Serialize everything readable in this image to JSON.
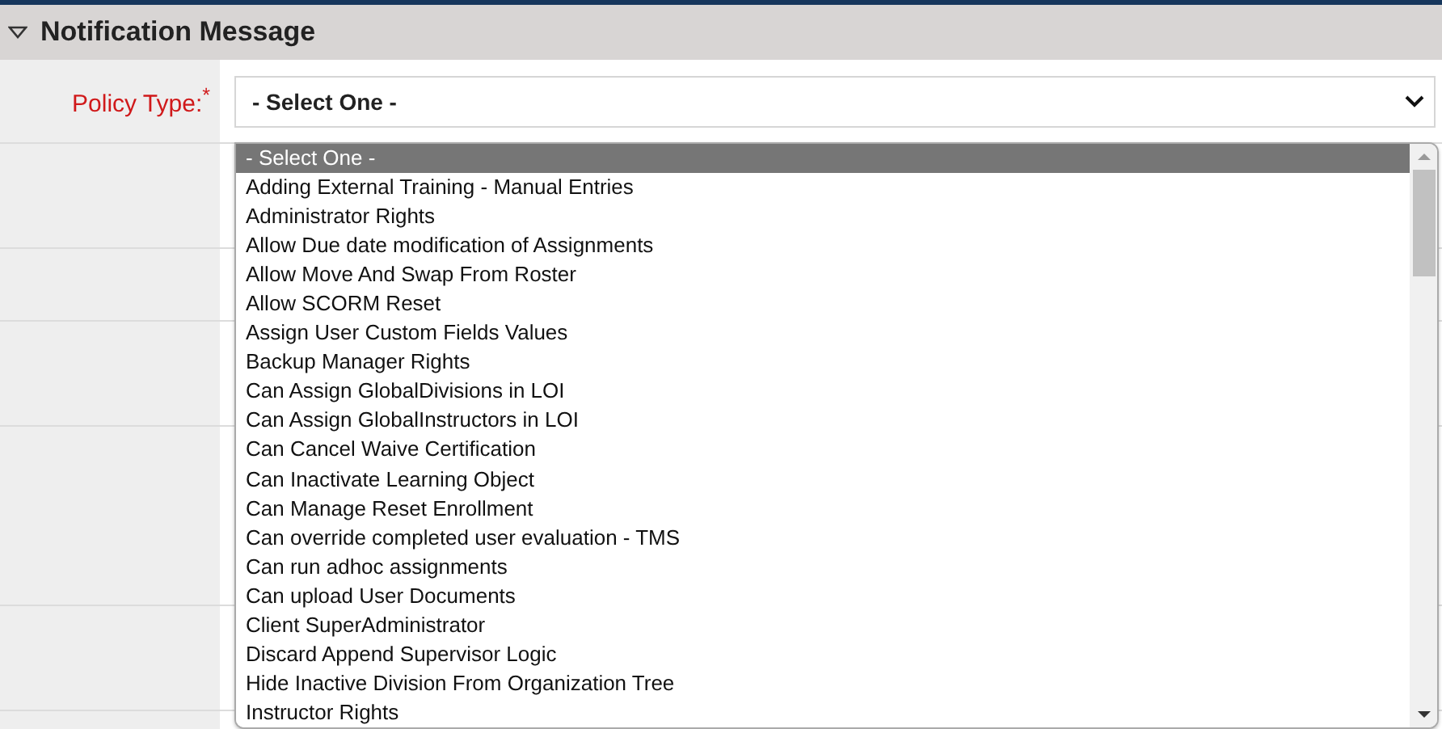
{
  "section": {
    "title": "Notification Message",
    "expanded": true
  },
  "field": {
    "label": "Policy Type:",
    "required": true,
    "required_mark": "*",
    "value": "- Select One -"
  },
  "options": [
    {
      "label": "- Select One -",
      "selected": true
    },
    {
      "label": "Adding External Training - Manual Entries",
      "selected": false
    },
    {
      "label": "Administrator Rights",
      "selected": false
    },
    {
      "label": "Allow Due date modification of Assignments",
      "selected": false
    },
    {
      "label": "Allow Move And Swap From Roster",
      "selected": false
    },
    {
      "label": "Allow SCORM Reset",
      "selected": false
    },
    {
      "label": "Assign User Custom Fields Values",
      "selected": false
    },
    {
      "label": "Backup Manager Rights",
      "selected": false
    },
    {
      "label": "Can Assign GlobalDivisions in LOI",
      "selected": false
    },
    {
      "label": "Can Assign GlobalInstructors in LOI",
      "selected": false
    },
    {
      "label": "Can Cancel Waive Certification",
      "selected": false
    },
    {
      "label": "Can Inactivate Learning Object",
      "selected": false
    },
    {
      "label": "Can Manage Reset Enrollment",
      "selected": false
    },
    {
      "label": "Can override completed user evaluation - TMS",
      "selected": false
    },
    {
      "label": "Can run adhoc assignments",
      "selected": false
    },
    {
      "label": "Can upload User Documents",
      "selected": false
    },
    {
      "label": "Client SuperAdministrator",
      "selected": false
    },
    {
      "label": "Discard Append Supervisor Logic",
      "selected": false
    },
    {
      "label": "Hide Inactive Division From Organization Tree",
      "selected": false
    },
    {
      "label": "Instructor Rights",
      "selected": false
    }
  ]
}
